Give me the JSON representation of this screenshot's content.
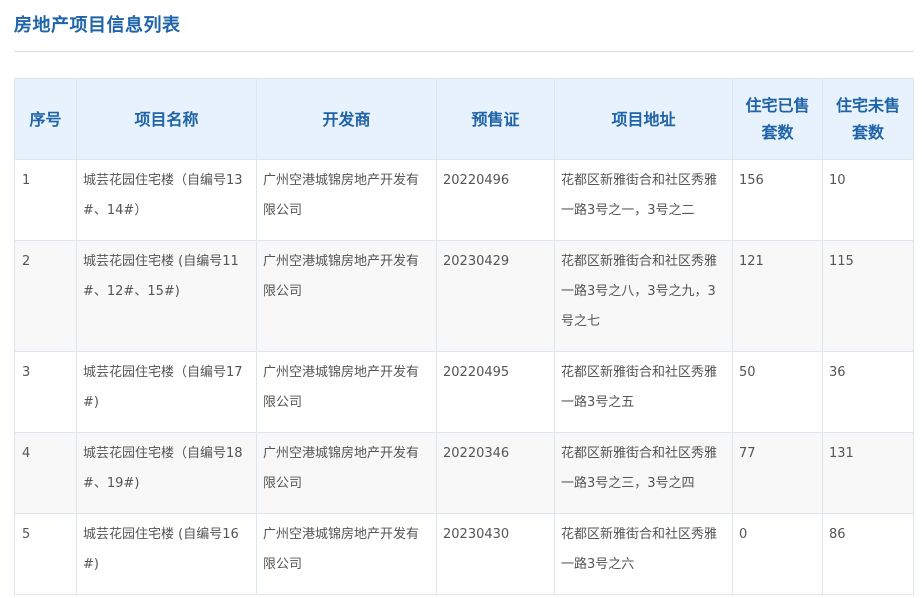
{
  "page": {
    "title": "房地产项目信息列表"
  },
  "table": {
    "headers": {
      "index": "序号",
      "name": "项目名称",
      "developer": "开发商",
      "permit": "预售证",
      "address": "项目地址",
      "sold": "住宅已售套数",
      "unsold": "住宅未售套数"
    },
    "rows": [
      {
        "index": "1",
        "name": "城芸花园住宅楼（自编号13#、14#）",
        "developer": "广州空港城锦房地产开发有限公司",
        "permit": "20220496",
        "address": "花都区新雅街合和社区秀雅一路3号之一，3号之二",
        "sold": "156",
        "unsold": "10"
      },
      {
        "index": "2",
        "name": "城芸花园住宅楼 (自编号11#、12#、15#)",
        "developer": "广州空港城锦房地产开发有限公司",
        "permit": "20230429",
        "address": "花都区新雅街合和社区秀雅一路3号之八，3号之九，3号之七",
        "sold": "121",
        "unsold": "115"
      },
      {
        "index": "3",
        "name": "城芸花园住宅楼（自编号17#)",
        "developer": "广州空港城锦房地产开发有限公司",
        "permit": "20220495",
        "address": "花都区新雅街合和社区秀雅一路3号之五",
        "sold": "50",
        "unsold": "36"
      },
      {
        "index": "4",
        "name": "城芸花园住宅楼（自编号18#、19#)",
        "developer": "广州空港城锦房地产开发有限公司",
        "permit": "20220346",
        "address": "花都区新雅街合和社区秀雅一路3号之三，3号之四",
        "sold": "77",
        "unsold": "131"
      },
      {
        "index": "5",
        "name": "城芸花园住宅楼 (自编号16#)",
        "developer": "广州空港城锦房地产开发有限公司",
        "permit": "20230430",
        "address": "花都区新雅街合和社区秀雅一路3号之六",
        "sold": "0",
        "unsold": "86"
      }
    ]
  }
}
